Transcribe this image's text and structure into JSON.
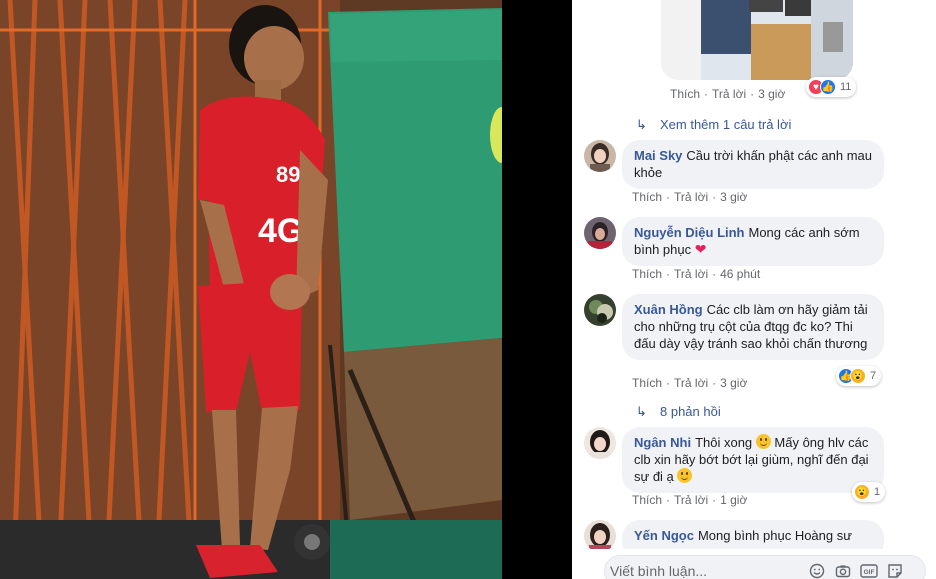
{
  "photo": {
    "jersey_number": "89",
    "jersey_text": "4G"
  },
  "top_comment": {
    "actions": [
      "Thích",
      "Trả lời"
    ],
    "time": "3 giờ",
    "reactions": [
      "love",
      "like"
    ],
    "reaction_count": "11"
  },
  "replies_link_1": {
    "text": "Xem thêm 1 câu trả lời"
  },
  "comments": [
    {
      "name": "Mai Sky",
      "text": "Cầu trời khấn phật các anh mau khỏe",
      "like": "Thích",
      "reply": "Trả lời",
      "time": "3 giờ"
    },
    {
      "name": "Nguyễn Diệu Linh",
      "text": "Mong các anh sớm bình phục",
      "emoji": "heart",
      "like": "Thích",
      "reply": "Trả lời",
      "time": "46 phút"
    },
    {
      "name": "Xuân Hồng",
      "text": "Các clb làm ơn hãy giảm tải cho những trụ cột của đtqg đc ko? Thi đấu dày vậy tránh sao khỏi chấn thương",
      "like": "Thích",
      "reply": "Trả lời",
      "time": "3 giờ",
      "reactions": [
        "like",
        "wow"
      ],
      "reaction_count": "7"
    },
    {
      "name": "Ngân Nhi",
      "text_a": "Thôi xong",
      "text_b": "Mấy ông hlv các clb xin hãy bớt bớt lại giùm, nghĩ đến đại sự đi ạ",
      "like": "Thích",
      "reply": "Trả lời",
      "time": "1 giờ",
      "reactions": [
        "wow"
      ],
      "reaction_count": "1"
    },
    {
      "name": "Yến Ngọc",
      "text": "Mong bình phục Hoàng sư"
    }
  ],
  "replies_link_2": {
    "text": "8 phản hồi"
  },
  "composer": {
    "placeholder": "Viết bình luận...",
    "icons": [
      "emoji-icon",
      "camera-icon",
      "gif-icon",
      "sticker-icon"
    ]
  }
}
